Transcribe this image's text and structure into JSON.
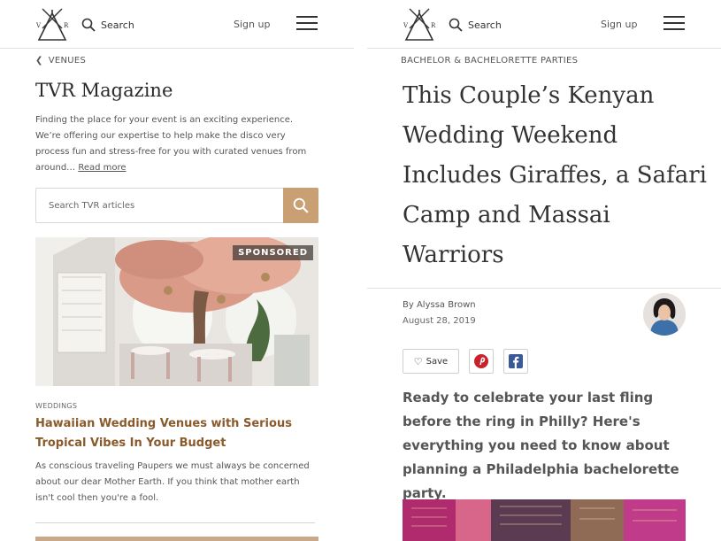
{
  "header": {
    "search_label": "Search",
    "signup_label": "Sign up",
    "logo_letters": [
      "V",
      "R"
    ],
    "menu_icon": "hamburger-icon"
  },
  "left": {
    "breadcrumb": "VENUES",
    "title": "TVR Magazine",
    "description": "Finding the place for your event is an exciting experience. We’re offering our expertise to help make the disco very process fun and stress-free for you with curated venues from around…",
    "read_more": "Read more",
    "search_placeholder": "Search TVR articles",
    "featured": {
      "badge": "SPONSORED",
      "category": "WEDDINGS",
      "title": "Hawaiian Wedding Venues with Serious Tropical Vibes In Your Budget",
      "summary": "As conscious traveling Paupers we must always be concerned about our dear Mother Earth. If you think that mother earth isn't cool then you're a fool."
    }
  },
  "right": {
    "category": "BACHELOR & BACHELORETTE PARTIES",
    "title": "This Couple’s Kenyan Wedding Weekend Includes Giraffes, a Safari Camp and Massai Warriors",
    "byline_prefix": "By",
    "author": "Alyssa Brown",
    "date": "August 28, 2019",
    "save_label": "Save",
    "share": [
      "pinterest-icon",
      "facebook-icon"
    ],
    "lede": "Ready to celebrate your last fling before the ring in Philly? Here's everything you need to know about planning a Philadelphia bachelorette party."
  },
  "colors": {
    "accent": "#c8a073",
    "link_title": "#8a5a2b",
    "pinterest": "#c8232c",
    "facebook": "#3b5998"
  }
}
